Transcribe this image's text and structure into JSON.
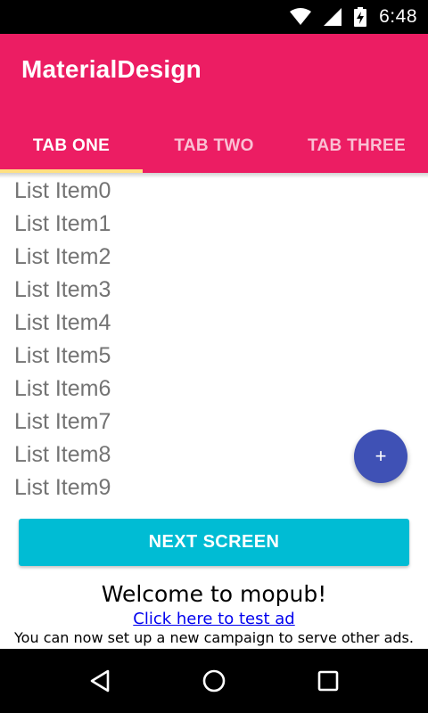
{
  "status_bar": {
    "time": "6:48",
    "icons": [
      "wifi-icon",
      "signal-icon",
      "battery-icon"
    ]
  },
  "app_bar": {
    "title": "MaterialDesign",
    "color": "#EC1D63",
    "tabs": [
      {
        "label": "TAB ONE",
        "selected": true
      },
      {
        "label": "TAB TWO",
        "selected": false
      },
      {
        "label": "TAB THREE",
        "selected": false
      }
    ],
    "indicator_color": "#FFE082"
  },
  "list": {
    "items": [
      "List Item0",
      "List Item1",
      "List Item2",
      "List Item3",
      "List Item4",
      "List Item5",
      "List Item6",
      "List Item7",
      "List Item8",
      "List Item9"
    ]
  },
  "fab": {
    "icon": "plus-icon",
    "label": "+",
    "color": "#3F51B5"
  },
  "next_button": {
    "label": "NEXT SCREEN",
    "color": "#00BCD4"
  },
  "ad": {
    "welcome": "Welcome to mopub!",
    "link": "Click here to test ad",
    "info": "You can now set up a new campaign to serve other ads."
  },
  "nav_bar": {
    "icons": [
      "back-icon",
      "home-icon",
      "recents-icon"
    ]
  }
}
